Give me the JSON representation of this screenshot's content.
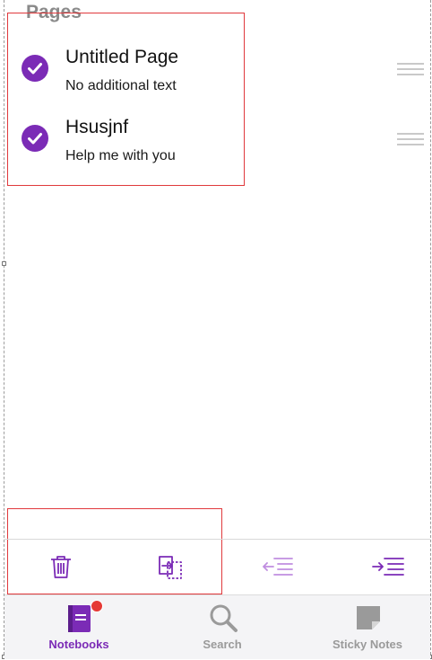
{
  "pages": {
    "section_title": "Pages",
    "items": [
      {
        "title": "Untitled Page",
        "subtitle": "No additional text",
        "selected": true
      },
      {
        "title": "Hsusjnf",
        "subtitle": "Help me with you",
        "selected": true
      }
    ]
  },
  "toolbar": {
    "items": [
      {
        "icon": "trash-icon"
      },
      {
        "icon": "move-page-icon"
      },
      {
        "icon": "outdent-icon"
      },
      {
        "icon": "indent-icon"
      }
    ]
  },
  "tabbar": {
    "items": [
      {
        "label": "Notebooks",
        "icon": "notebook-icon",
        "active": true,
        "badge": true
      },
      {
        "label": "Search",
        "icon": "search-icon",
        "active": false
      },
      {
        "label": "Sticky Notes",
        "icon": "sticky-note-icon",
        "active": false
      }
    ]
  },
  "colors": {
    "accent": "#7b2bb6",
    "inactive": "#9a9a9a",
    "annotation": "#e0393c",
    "badge": "#e53935"
  }
}
